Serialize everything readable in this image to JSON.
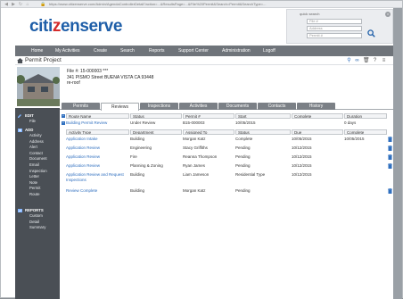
{
  "browser": {
    "url": "https://www.citizenserve.com/Admin/AgendaControllerDetail?action=...&ResultsPage=...&File%20Permit&Search=Permit&SearchType=..."
  },
  "header": {
    "logo_part1": "citi",
    "logo_part2": "z",
    "logo_part3": "enserve",
    "quick_search": {
      "title": "quick search",
      "fields": [
        "File #",
        "Address",
        "Permit #"
      ]
    }
  },
  "menu": [
    "Home",
    "My Activities",
    "Create",
    "Search",
    "Reports",
    "Support Center",
    "Administration",
    "Logoff"
  ],
  "page_title": "Permit Project",
  "file": {
    "line1": "File #: 15-000003 ***",
    "line2": "341 PISMO Street BUENA VISTA CA 93448",
    "line3": "re-roof"
  },
  "sidebar": {
    "edit_head": "EDIT",
    "edit_items": [
      "File"
    ],
    "add_head": "ADD",
    "add_items": [
      "Activity",
      "Address",
      "Alert",
      "Contact",
      "Document",
      "Email",
      "Inspection",
      "Letter",
      "Note",
      "Permit",
      "Route"
    ],
    "reports_head": "REPORTS",
    "reports_items": [
      "Custom",
      "Detail",
      "Summary"
    ]
  },
  "tabs": [
    "Permits",
    "Reviews",
    "Inspections",
    "Activities",
    "Documents",
    "Contacts",
    "History"
  ],
  "active_tab": "Reviews",
  "route_headers": [
    "Route Name",
    "Status",
    "Permit #",
    "Start",
    "Complete",
    "Duration"
  ],
  "route_row": {
    "name": "Building Permit Review",
    "status": "Under Review",
    "permit": "B15-000003",
    "start": "10/05/2015",
    "complete": "",
    "duration": "0 days"
  },
  "activity_headers": [
    "Activity Type",
    "Department",
    "Assigned To",
    "Status",
    "Due",
    "Complete"
  ],
  "activities": [
    {
      "type": "Application Intake",
      "dept": "Building",
      "assigned": "Morgan Katz",
      "status": "Complete",
      "due": "10/05/2015",
      "complete": "10/05/2015"
    },
    {
      "type": "Application Review",
      "dept": "Engineering",
      "assigned": "Stacy Griffiths",
      "status": "Pending",
      "due": "10/12/2015",
      "complete": ""
    },
    {
      "type": "Application Review",
      "dept": "Fire",
      "assigned": "Reanna Thompson",
      "status": "Pending",
      "due": "10/12/2015",
      "complete": ""
    },
    {
      "type": "Application Review",
      "dept": "Planning & Zoning",
      "assigned": "Ryan James",
      "status": "Pending",
      "due": "10/12/2015",
      "complete": ""
    },
    {
      "type": "Application Review and Request Inspections",
      "dept": "Building",
      "assigned": "Liam Jameson",
      "status": "Residential Type",
      "due": "10/12/2015",
      "complete": ""
    },
    {
      "type": "Review Complete",
      "dept": "Building",
      "assigned": "Morgan Katz",
      "status": "Pending",
      "due": "",
      "complete": ""
    }
  ],
  "colors": {
    "menubar": "#6f747a",
    "sidebar": "#4a4f55",
    "link": "#2f6fbf",
    "logo_blue": "#1e5ea8",
    "logo_red": "#d42b2b"
  }
}
